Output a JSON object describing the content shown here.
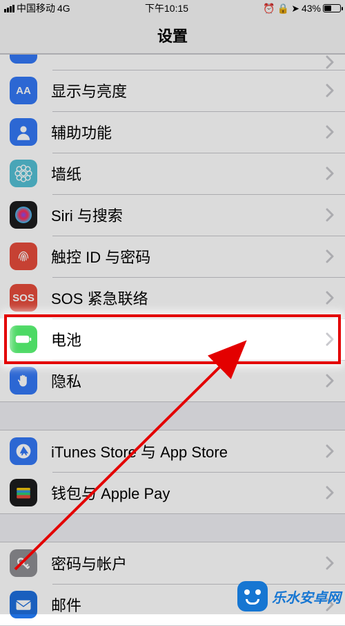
{
  "status": {
    "carrier": "中国移动",
    "network": "4G",
    "time": "下午10:15",
    "icons": [
      "alarm",
      "lock-rotation",
      "location"
    ],
    "battery_pct": "43%"
  },
  "nav": {
    "title": "设置"
  },
  "groups": [
    {
      "partial_first": true,
      "items": [
        {
          "id": "prev",
          "label": "",
          "icon": "generic",
          "color": "#3478f6"
        },
        {
          "id": "display",
          "label": "显示与亮度",
          "icon": "AA",
          "color": "#3478f6"
        },
        {
          "id": "accessibility",
          "label": "辅助功能",
          "icon": "person",
          "color": "#3478f6"
        },
        {
          "id": "wallpaper",
          "label": "墙纸",
          "icon": "flower",
          "color": "#54c1d6"
        },
        {
          "id": "siri",
          "label": "Siri 与搜索",
          "icon": "siri",
          "color": "#1c1c1e"
        },
        {
          "id": "touchid",
          "label": "触控 ID 与密码",
          "icon": "fingerprint",
          "color": "#e74c3c"
        },
        {
          "id": "sos",
          "label": "SOS 紧急联络",
          "icon": "SOS",
          "color": "#e74c3c"
        },
        {
          "id": "battery",
          "label": "电池",
          "icon": "battery",
          "color": "#4cd964",
          "highlighted": true
        },
        {
          "id": "privacy",
          "label": "隐私",
          "icon": "hand",
          "color": "#3478f6"
        }
      ]
    },
    {
      "items": [
        {
          "id": "itunes",
          "label": "iTunes Store 与 App Store",
          "icon": "appstore",
          "color": "#3478f6"
        },
        {
          "id": "wallet",
          "label": "钱包与 Apple Pay",
          "icon": "wallet",
          "color": "#1c1c1e"
        }
      ]
    },
    {
      "items": [
        {
          "id": "passwords",
          "label": "密码与帐户",
          "icon": "key",
          "color": "#8e8e93"
        },
        {
          "id": "mail",
          "label": "邮件",
          "icon": "mail",
          "color": "#1f6fde"
        }
      ]
    }
  ],
  "watermark": {
    "text": "乐水安卓网"
  },
  "chevron_svg": "<svg width='12' height='20' viewBox='0 0 12 20'><path d='M2 2 L10 10 L2 18' stroke='#c7c7cc' stroke-width='3' fill='none' stroke-linecap='round' stroke-linejoin='round'/></svg>",
  "icons_svg": {
    "person": "<svg viewBox='0 0 40 40' width='26' height='26'><circle cx='20' cy='14' r='7' fill='#fff'/><path d='M6 38c0-9 7-14 14-14s14 5 14 14' fill='#fff'/></svg>",
    "flower": "<svg viewBox='0 0 40 40' width='28' height='28'><g fill='none' stroke='#fff' stroke-width='2'><circle cx='20' cy='20' r='5'/><circle cx='20' cy='8' r='5'/><circle cx='20' cy='32' r='5'/><circle cx='8' cy='20' r='5'/><circle cx='32' cy='20' r='5'/><circle cx='11' cy='11' r='5'/><circle cx='29' cy='11' r='5'/><circle cx='11' cy='29' r='5'/><circle cx='29' cy='29' r='5'/></g></svg>",
    "siri": "<svg viewBox='0 0 40 40' width='30' height='30'><defs><radialGradient id='sg'><stop offset='0%' stop-color='#7a4fff'/><stop offset='50%' stop-color='#ff2d55'/><stop offset='100%' stop-color='#34c8ff'/></radialGradient></defs><circle cx='20' cy='20' r='16' fill='url(#sg)'/></svg>",
    "fingerprint": "<svg viewBox='0 0 40 40' width='26' height='26'><g fill='none' stroke='#fff' stroke-width='2' stroke-linecap='round'><path d='M10 24c0-8 5-14 10-14s10 6 10 14'/><path d='M14 28c0-8 3-14 6-14s6 6 6 14'/><path d='M18 30c0-7 1-12 2-12s2 5 2 12'/></g></svg>",
    "battery": "<svg viewBox='0 0 40 40' width='30' height='30'><rect x='5' y='13' width='26' height='14' rx='4' fill='#fff'/><rect x='32' y='17' width='3' height='6' rx='1' fill='#fff'/></svg>",
    "hand": "<svg viewBox='0 0 40 40' width='24' height='24'><path fill='#fff' d='M12 20V10c0-1 1-2 2-2s2 1 2 2v8V8c0-1 1-2 2-2s2 1 2 2v10V9c0-1 1-2 2-2s2 1 2 2v10V12c0-1 1-2 2-2s2 1 2 2v12c0 6-4 10-9 10s-9-4-9-10l-3-4c-1-1 0-3 1-3s2 1 2 3z'/></svg>",
    "appstore": "<svg viewBox='0 0 40 40' width='26' height='26'><circle cx='20' cy='20' r='16' fill='#fff'/><path d='M20 9l-8 16h5l-2 4h3l2-4h3l2 4h3l-2-4h5L20 9z' fill='#3478f6'/></svg>",
    "wallet": "<svg viewBox='0 0 40 40' width='28' height='28'><rect x='6' y='10' width='28' height='6' rx='2' fill='#f1c40f'/><rect x='6' y='15' width='28' height='6' rx='2' fill='#3498db'/><rect x='6' y='20' width='28' height='6' rx='2' fill='#2ecc71'/><rect x='6' y='25' width='28' height='7' rx='2' fill='#e74c3c'/></svg>",
    "key": "<svg viewBox='0 0 40 40' width='24' height='24'><circle cx='14' cy='16' r='7' fill='none' stroke='#fff' stroke-width='4'/><path d='M18 20l12 12 M26 28l4-4 M30 32l3-3' stroke='#fff' stroke-width='4' fill='none' stroke-linecap='round'/></svg>",
    "mail": "<svg viewBox='0 0 40 40' width='28' height='28'><rect x='5' y='11' width='30' height='20' rx='3' fill='#fff'/><path d='M5 13l15 11 15-11' stroke='#1f6fde' stroke-width='2' fill='none'/></svg>",
    "generic": ""
  }
}
